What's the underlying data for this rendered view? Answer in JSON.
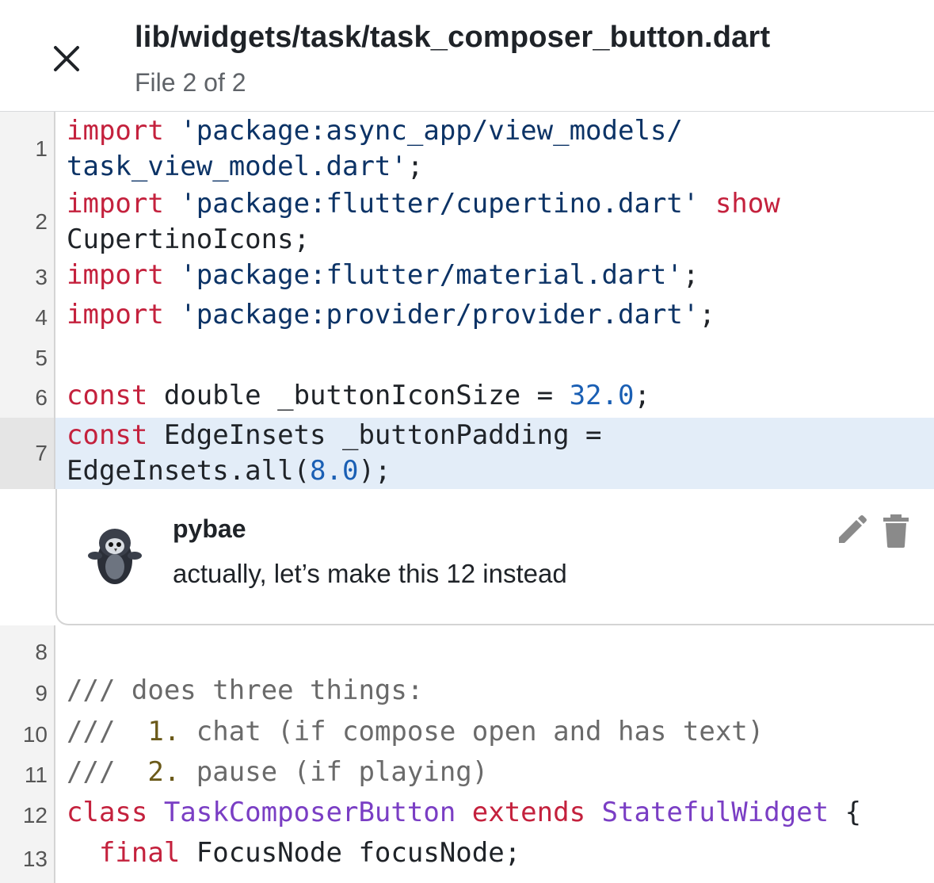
{
  "header": {
    "title": "lib/widgets/task/task_composer_button.dart",
    "subtitle": "File 2 of 2"
  },
  "code_lines": {
    "l1": {
      "num": "1",
      "a1": "import",
      "a2": " 'package:async_app/view_models/",
      "b1": "task_view_model.dart'",
      "b2": ";"
    },
    "l2": {
      "num": "2",
      "a1": "import",
      "a2": " 'package:flutter/cupertino.dart'",
      "a3": " show",
      "b1": "CupertinoIcons;"
    },
    "l3": {
      "num": "3",
      "a1": "import",
      "a2": " 'package:flutter/material.dart'",
      "a3": ";"
    },
    "l4": {
      "num": "4",
      "a1": "import",
      "a2": " 'package:provider/provider.dart'",
      "a3": ";"
    },
    "l5": {
      "num": "5"
    },
    "l6": {
      "num": "6",
      "a1": "const",
      "a2": " double _buttonIconSize = ",
      "a3": "32.0",
      "a4": ";"
    },
    "l7": {
      "num": "7",
      "a1": "const",
      "a2": " EdgeInsets _buttonPadding =",
      "b1": "EdgeInsets.all(",
      "b2": "8.0",
      "b3": ");"
    },
    "l8": {
      "num": "8"
    },
    "l9": {
      "num": "9",
      "a1": "/// does three things:"
    },
    "l10": {
      "num": "10",
      "a1": "///  ",
      "a2": "1.",
      "a3": " chat (if compose open and has text)"
    },
    "l11": {
      "num": "11",
      "a1": "///  ",
      "a2": "2.",
      "a3": " pause (if playing)"
    },
    "l12": {
      "num": "12",
      "a1": "class",
      "a2": " TaskComposerButton",
      "a3": " extends",
      "a4": " StatefulWidget",
      "a5": " {"
    },
    "l13": {
      "num": "13",
      "a1": "  final",
      "a2": " FocusNode focusNode;"
    }
  },
  "comment": {
    "author": "pybae",
    "body": "actually, let’s make this 12 instead"
  },
  "icons": {
    "close": "close-icon",
    "edit": "pencil-icon",
    "delete": "trash-icon"
  },
  "colors": {
    "keyword": "#c4213d",
    "string": "#0c3366",
    "number": "#1a5fb4",
    "comment": "#6a6a6a",
    "type": "#7a3ec4",
    "highlight": "#e3edf8"
  }
}
